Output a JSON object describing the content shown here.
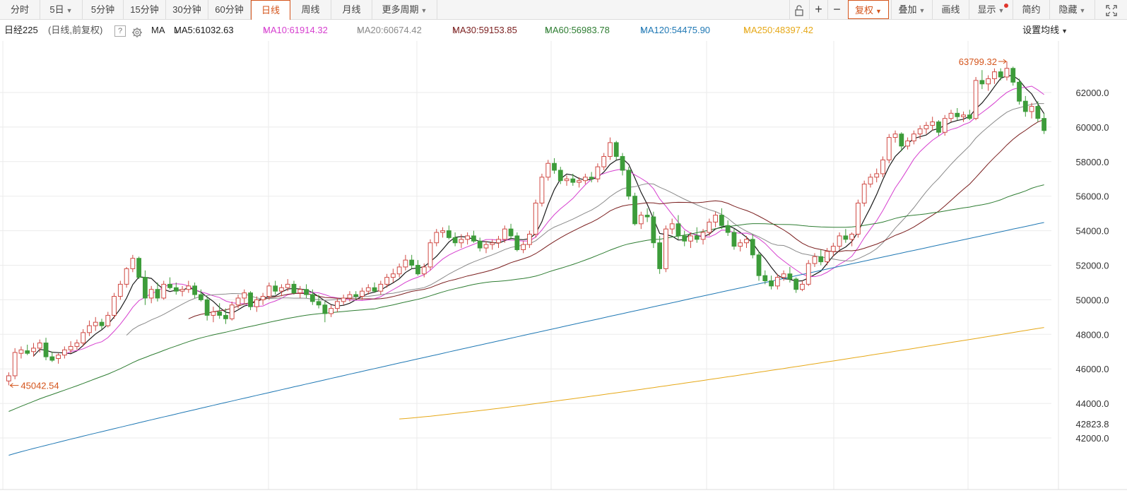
{
  "toolbar": {
    "periods": [
      "分时",
      "5日",
      "5分钟",
      "15分钟",
      "30分钟",
      "60分钟",
      "日线",
      "周线",
      "月线",
      "更多周期"
    ],
    "active_period": "日线",
    "tools": {
      "lock": "lock-icon",
      "zoom_in": "+",
      "zoom_out": "−",
      "fuquan": "复权",
      "overlay": "叠加",
      "draw": "画线",
      "display": "显示",
      "simple": "简约",
      "hide": "隐藏",
      "fullscreen": "fullscreen-icon"
    }
  },
  "ma_bar": {
    "instrument": "日经225",
    "mode": "(日线,前复权)",
    "help": "?",
    "gear": "gear-icon",
    "ma_label": "MA",
    "settings": "设置均线",
    "items": [
      {
        "text": "MA5:61032.63",
        "arrow": "↓",
        "color": "#1a1a1a"
      },
      {
        "text": "MA10:61914.32",
        "arrow": "↑",
        "color": "#d63fcf"
      },
      {
        "text": "MA20:60674.42",
        "arrow": "↑",
        "color": "#8a8a8a"
      },
      {
        "text": "MA30:59153.85",
        "arrow": "↑",
        "color": "#7a1e1e"
      },
      {
        "text": "MA60:56983.78",
        "arrow": "↑",
        "color": "#2e7d32"
      },
      {
        "text": "MA120:54475.90",
        "arrow": "↑",
        "color": "#1f78b4"
      },
      {
        "text": "MA250:48397.42",
        "arrow": "↑",
        "color": "#e6a817"
      }
    ]
  },
  "chart_data": {
    "type": "candlestick",
    "ylim": [
      40000,
      65000
    ],
    "y_ticks": [
      "42000.0",
      "44000.0",
      "46000.0",
      "48000.0",
      "50000.0",
      "52000.0",
      "54000.0",
      "56000.0",
      "58000.0",
      "60000.0",
      "62000.0"
    ],
    "y_min_label": "42823.8",
    "low_marker": "45042.54",
    "high_marker": "63799.32",
    "colors": {
      "up": "#d04a44",
      "down": "#3d9c3a",
      "grid": "#ebebeb"
    },
    "candles": [
      [
        45300,
        45800,
        45050,
        45600
      ],
      [
        45600,
        47200,
        45400,
        46950
      ],
      [
        46900,
        47300,
        46600,
        47100
      ],
      [
        47050,
        47400,
        46800,
        46900
      ],
      [
        47000,
        47500,
        46700,
        47200
      ],
      [
        47200,
        47700,
        46950,
        47500
      ],
      [
        47500,
        47800,
        46500,
        46700
      ],
      [
        46700,
        47000,
        46400,
        46500
      ],
      [
        46600,
        46900,
        46300,
        46800
      ],
      [
        46800,
        47300,
        46600,
        47100
      ],
      [
        47100,
        47600,
        46900,
        47300
      ],
      [
        47300,
        47700,
        47100,
        47500
      ],
      [
        47500,
        48300,
        47300,
        48100
      ],
      [
        48100,
        48800,
        47900,
        48500
      ],
      [
        48500,
        49000,
        48200,
        48700
      ],
      [
        48700,
        48900,
        48300,
        48500
      ],
      [
        48500,
        49300,
        48400,
        49100
      ],
      [
        49100,
        50400,
        48900,
        50200
      ],
      [
        50200,
        51100,
        50000,
        50900
      ],
      [
        50900,
        51900,
        50700,
        51800
      ],
      [
        51800,
        52600,
        51600,
        52400
      ],
      [
        52400,
        52500,
        51200,
        51300
      ],
      [
        51300,
        51700,
        49700,
        50100
      ],
      [
        50100,
        50800,
        49800,
        50600
      ],
      [
        50600,
        51000,
        49900,
        50100
      ],
      [
        50100,
        51100,
        50000,
        50900
      ],
      [
        50900,
        51300,
        50600,
        50700
      ],
      [
        50700,
        51000,
        50300,
        50500
      ],
      [
        50500,
        50800,
        50200,
        50600
      ],
      [
        50600,
        51100,
        50400,
        50800
      ],
      [
        50800,
        51000,
        50100,
        50300
      ],
      [
        50300,
        50600,
        49900,
        50000
      ],
      [
        50000,
        50200,
        48800,
        49100
      ],
      [
        49100,
        49600,
        48700,
        49300
      ],
      [
        49300,
        49800,
        48900,
        49100
      ],
      [
        49100,
        49500,
        48600,
        48900
      ],
      [
        48900,
        49900,
        48800,
        49700
      ],
      [
        49700,
        50300,
        49500,
        50100
      ],
      [
        50100,
        50600,
        49800,
        50400
      ],
      [
        50400,
        50500,
        49400,
        49600
      ],
      [
        49600,
        50200,
        49300,
        50000
      ],
      [
        50000,
        50400,
        49700,
        50200
      ],
      [
        50200,
        51000,
        50000,
        50800
      ],
      [
        50800,
        51100,
        50300,
        50500
      ],
      [
        50500,
        50900,
        50200,
        50700
      ],
      [
        50700,
        51200,
        50500,
        50900
      ],
      [
        50900,
        51100,
        50300,
        50400
      ],
      [
        50400,
        50800,
        50100,
        50600
      ],
      [
        50600,
        50900,
        50100,
        50300
      ],
      [
        50300,
        50600,
        49700,
        49900
      ],
      [
        49900,
        50300,
        49500,
        49700
      ],
      [
        49700,
        49900,
        48700,
        49200
      ],
      [
        49200,
        49700,
        49000,
        49500
      ],
      [
        49500,
        50100,
        49300,
        49900
      ],
      [
        49900,
        50300,
        49700,
        50100
      ],
      [
        50100,
        50500,
        49900,
        50300
      ],
      [
        50300,
        50500,
        50000,
        50200
      ],
      [
        50200,
        50700,
        50000,
        50500
      ],
      [
        50500,
        50900,
        50300,
        50700
      ],
      [
        50700,
        51000,
        50400,
        50500
      ],
      [
        50500,
        51100,
        50300,
        50900
      ],
      [
        50900,
        51500,
        50700,
        51300
      ],
      [
        51300,
        51800,
        51000,
        51500
      ],
      [
        51500,
        52100,
        51300,
        51900
      ],
      [
        51900,
        52600,
        51700,
        52300
      ],
      [
        52300,
        52600,
        51800,
        52000
      ],
      [
        52000,
        52300,
        51400,
        51500
      ],
      [
        51500,
        52100,
        51300,
        51900
      ],
      [
        51900,
        53500,
        51700,
        53300
      ],
      [
        53300,
        54100,
        53100,
        53900
      ],
      [
        53900,
        54200,
        53600,
        54000
      ],
      [
        54000,
        54300,
        53500,
        53600
      ],
      [
        53600,
        53900,
        53100,
        53300
      ],
      [
        53300,
        53800,
        53000,
        53500
      ],
      [
        53500,
        53900,
        53200,
        53700
      ],
      [
        53700,
        54000,
        53300,
        53400
      ],
      [
        53400,
        53600,
        52800,
        53000
      ],
      [
        53000,
        53400,
        52700,
        53200
      ],
      [
        53200,
        53500,
        52900,
        53300
      ],
      [
        53300,
        53700,
        53000,
        53500
      ],
      [
        53500,
        54300,
        53300,
        54100
      ],
      [
        54100,
        54400,
        53500,
        53700
      ],
      [
        53700,
        53900,
        52800,
        52900
      ],
      [
        52900,
        53400,
        52700,
        53200
      ],
      [
        53200,
        54000,
        53000,
        53800
      ],
      [
        53800,
        55800,
        53600,
        55600
      ],
      [
        55600,
        57300,
        55400,
        57100
      ],
      [
        57100,
        58100,
        56900,
        57900
      ],
      [
        57900,
        58200,
        57300,
        57500
      ],
      [
        57500,
        57700,
        56700,
        56900
      ],
      [
        56900,
        57200,
        56600,
        57000
      ],
      [
        57000,
        57300,
        56600,
        56800
      ],
      [
        56800,
        57100,
        56500,
        56900
      ],
      [
        56900,
        57300,
        56700,
        57100
      ],
      [
        57100,
        57400,
        56800,
        57000
      ],
      [
        57000,
        57900,
        56800,
        57700
      ],
      [
        57700,
        58500,
        57500,
        58300
      ],
      [
        58300,
        59400,
        58100,
        59100
      ],
      [
        59100,
        59200,
        58100,
        58300
      ],
      [
        58300,
        58500,
        57200,
        57500
      ],
      [
        57500,
        57700,
        55800,
        56000
      ],
      [
        56000,
        56200,
        54300,
        54400
      ],
      [
        54400,
        55100,
        54100,
        54900
      ],
      [
        54900,
        55300,
        54500,
        54800
      ],
      [
        54800,
        55100,
        53000,
        53300
      ],
      [
        53300,
        53700,
        51500,
        51800
      ],
      [
        51800,
        54300,
        51600,
        54100
      ],
      [
        54100,
        54700,
        53800,
        54400
      ],
      [
        54400,
        54900,
        53500,
        53700
      ],
      [
        53700,
        54000,
        53100,
        53400
      ],
      [
        53400,
        53900,
        53000,
        53700
      ],
      [
        53700,
        54200,
        53300,
        53500
      ],
      [
        53500,
        54100,
        53200,
        53900
      ],
      [
        53900,
        54700,
        53700,
        54500
      ],
      [
        54500,
        55100,
        54200,
        54900
      ],
      [
        54900,
        55300,
        54100,
        54300
      ],
      [
        54300,
        54600,
        53700,
        53900
      ],
      [
        53900,
        54100,
        52900,
        53100
      ],
      [
        53100,
        53500,
        52800,
        53300
      ],
      [
        53300,
        53700,
        53000,
        53500
      ],
      [
        53500,
        53800,
        52400,
        52600
      ],
      [
        52600,
        52800,
        51100,
        51400
      ],
      [
        51400,
        51700,
        50900,
        51100
      ],
      [
        51100,
        51400,
        50600,
        50800
      ],
      [
        50800,
        51500,
        50600,
        51300
      ],
      [
        51300,
        51700,
        51100,
        51500
      ],
      [
        51500,
        51900,
        51000,
        51200
      ],
      [
        51200,
        51300,
        50400,
        50600
      ],
      [
        50600,
        51100,
        50500,
        50900
      ],
      [
        50900,
        52300,
        50800,
        52100
      ],
      [
        52100,
        52700,
        51900,
        52500
      ],
      [
        52500,
        52900,
        52000,
        52200
      ],
      [
        52200,
        53000,
        52000,
        52800
      ],
      [
        52800,
        53300,
        52500,
        53100
      ],
      [
        53100,
        53900,
        52900,
        53700
      ],
      [
        53700,
        54100,
        53300,
        53500
      ],
      [
        53500,
        53900,
        53100,
        53800
      ],
      [
        53800,
        55800,
        53600,
        55600
      ],
      [
        55600,
        56900,
        55400,
        56700
      ],
      [
        56700,
        57300,
        56500,
        57100
      ],
      [
        57100,
        57600,
        56800,
        57300
      ],
      [
        57300,
        58300,
        57100,
        58100
      ],
      [
        58100,
        59600,
        57900,
        59400
      ],
      [
        59400,
        59800,
        59100,
        59600
      ],
      [
        59600,
        59700,
        58600,
        58900
      ],
      [
        58900,
        59400,
        58700,
        59200
      ],
      [
        59200,
        59800,
        59000,
        59600
      ],
      [
        59600,
        60100,
        59300,
        59900
      ],
      [
        59900,
        60300,
        59600,
        60100
      ],
      [
        60100,
        60600,
        59800,
        60300
      ],
      [
        60300,
        60400,
        59500,
        59700
      ],
      [
        59700,
        60700,
        59500,
        60500
      ],
      [
        60500,
        61000,
        60300,
        60800
      ],
      [
        60800,
        61100,
        60400,
        60600
      ],
      [
        60600,
        60900,
        60300,
        60700
      ],
      [
        60700,
        61000,
        60400,
        60500
      ],
      [
        60500,
        62900,
        60400,
        62700
      ],
      [
        62700,
        63300,
        62200,
        62500
      ],
      [
        62500,
        63000,
        62100,
        62800
      ],
      [
        62800,
        63400,
        62500,
        63200
      ],
      [
        63200,
        63400,
        62700,
        62900
      ],
      [
        62900,
        63800,
        62700,
        63400
      ],
      [
        63400,
        63500,
        62400,
        62600
      ],
      [
        62600,
        62800,
        61300,
        61500
      ],
      [
        61500,
        61800,
        60600,
        60900
      ],
      [
        60900,
        61400,
        60500,
        61200
      ],
      [
        61200,
        61500,
        60300,
        60500
      ],
      [
        60500,
        60800,
        59600,
        59800
      ]
    ]
  }
}
